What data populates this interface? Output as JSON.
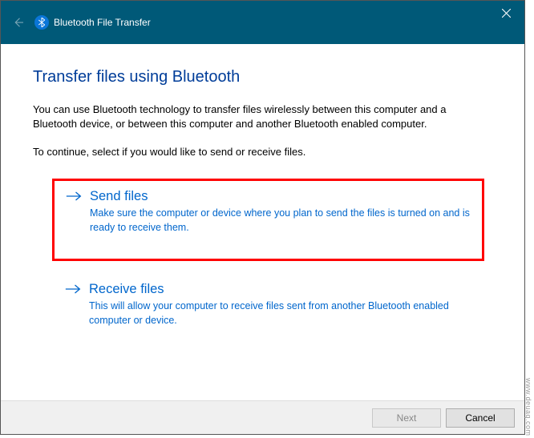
{
  "titlebar": {
    "title": "Bluetooth File Transfer"
  },
  "content": {
    "heading": "Transfer files using Bluetooth",
    "description": "You can use Bluetooth technology to transfer files wirelessly between this computer and a Bluetooth device, or between this computer and another Bluetooth enabled computer.",
    "instruction": "To continue, select if you would like to send or receive files."
  },
  "options": {
    "send": {
      "title": "Send files",
      "desc": "Make sure the computer or device where you plan to send the files is turned on and is ready to receive them."
    },
    "receive": {
      "title": "Receive files",
      "desc": "This will allow your computer to receive files sent from another Bluetooth enabled computer or device."
    }
  },
  "footer": {
    "next": "Next",
    "cancel": "Cancel"
  },
  "watermark": "www.deuaq.com"
}
